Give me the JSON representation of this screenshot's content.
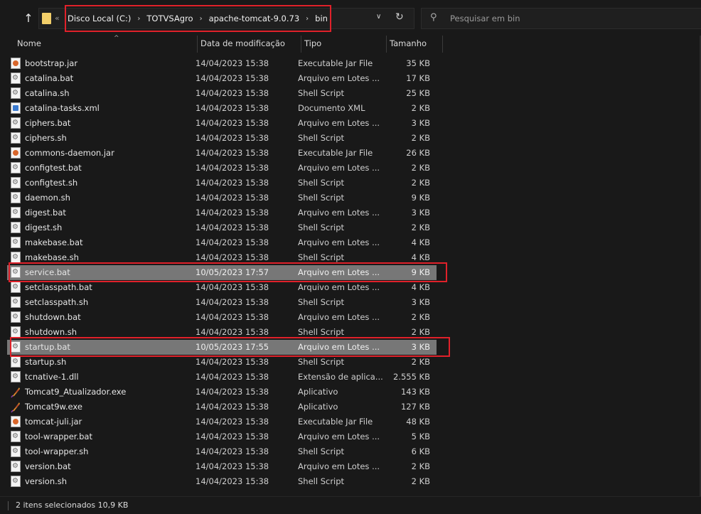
{
  "address": {
    "prefix": "«",
    "crumbs": [
      "Disco Local (C:)",
      "TOTVSAgro",
      "apache-tomcat-9.0.73",
      "bin"
    ]
  },
  "search": {
    "placeholder": "Pesquisar em bin"
  },
  "columns": {
    "name": "Nome",
    "date": "Data de modificação",
    "type": "Tipo",
    "size": "Tamanho"
  },
  "files": [
    {
      "name": "bootstrap.jar",
      "date": "14/04/2023 15:38",
      "type": "Executable Jar File",
      "size": "35 KB",
      "icon": "jar"
    },
    {
      "name": "catalina.bat",
      "date": "14/04/2023 15:38",
      "type": "Arquivo em Lotes ...",
      "size": "17 KB",
      "icon": "bat"
    },
    {
      "name": "catalina.sh",
      "date": "14/04/2023 15:38",
      "type": "Shell Script",
      "size": "25 KB",
      "icon": "sh"
    },
    {
      "name": "catalina-tasks.xml",
      "date": "14/04/2023 15:38",
      "type": "Documento XML",
      "size": "2 KB",
      "icon": "xml"
    },
    {
      "name": "ciphers.bat",
      "date": "14/04/2023 15:38",
      "type": "Arquivo em Lotes ...",
      "size": "3 KB",
      "icon": "bat"
    },
    {
      "name": "ciphers.sh",
      "date": "14/04/2023 15:38",
      "type": "Shell Script",
      "size": "2 KB",
      "icon": "sh"
    },
    {
      "name": "commons-daemon.jar",
      "date": "14/04/2023 15:38",
      "type": "Executable Jar File",
      "size": "26 KB",
      "icon": "jar"
    },
    {
      "name": "configtest.bat",
      "date": "14/04/2023 15:38",
      "type": "Arquivo em Lotes ...",
      "size": "2 KB",
      "icon": "bat"
    },
    {
      "name": "configtest.sh",
      "date": "14/04/2023 15:38",
      "type": "Shell Script",
      "size": "2 KB",
      "icon": "sh"
    },
    {
      "name": "daemon.sh",
      "date": "14/04/2023 15:38",
      "type": "Shell Script",
      "size": "9 KB",
      "icon": "sh"
    },
    {
      "name": "digest.bat",
      "date": "14/04/2023 15:38",
      "type": "Arquivo em Lotes ...",
      "size": "3 KB",
      "icon": "bat"
    },
    {
      "name": "digest.sh",
      "date": "14/04/2023 15:38",
      "type": "Shell Script",
      "size": "2 KB",
      "icon": "sh"
    },
    {
      "name": "makebase.bat",
      "date": "14/04/2023 15:38",
      "type": "Arquivo em Lotes ...",
      "size": "4 KB",
      "icon": "bat"
    },
    {
      "name": "makebase.sh",
      "date": "14/04/2023 15:38",
      "type": "Shell Script",
      "size": "4 KB",
      "icon": "sh"
    },
    {
      "name": "service.bat",
      "date": "10/05/2023 17:57",
      "type": "Arquivo em Lotes ...",
      "size": "9 KB",
      "icon": "bat",
      "selected": true
    },
    {
      "name": "setclasspath.bat",
      "date": "14/04/2023 15:38",
      "type": "Arquivo em Lotes ...",
      "size": "4 KB",
      "icon": "bat"
    },
    {
      "name": "setclasspath.sh",
      "date": "14/04/2023 15:38",
      "type": "Shell Script",
      "size": "3 KB",
      "icon": "sh"
    },
    {
      "name": "shutdown.bat",
      "date": "14/04/2023 15:38",
      "type": "Arquivo em Lotes ...",
      "size": "2 KB",
      "icon": "bat"
    },
    {
      "name": "shutdown.sh",
      "date": "14/04/2023 15:38",
      "type": "Shell Script",
      "size": "2 KB",
      "icon": "sh"
    },
    {
      "name": "startup.bat",
      "date": "10/05/2023 17:55",
      "type": "Arquivo em Lotes ...",
      "size": "3 KB",
      "icon": "bat",
      "selected": true
    },
    {
      "name": "startup.sh",
      "date": "14/04/2023 15:38",
      "type": "Shell Script",
      "size": "2 KB",
      "icon": "sh"
    },
    {
      "name": "tcnative-1.dll",
      "date": "14/04/2023 15:38",
      "type": "Extensão de aplica...",
      "size": "2.555 KB",
      "icon": "dll"
    },
    {
      "name": "Tomcat9_Atualizador.exe",
      "date": "14/04/2023 15:38",
      "type": "Aplicativo",
      "size": "143 KB",
      "icon": "exe"
    },
    {
      "name": "Tomcat9w.exe",
      "date": "14/04/2023 15:38",
      "type": "Aplicativo",
      "size": "127 KB",
      "icon": "exe"
    },
    {
      "name": "tomcat-juli.jar",
      "date": "14/04/2023 15:38",
      "type": "Executable Jar File",
      "size": "48 KB",
      "icon": "jar"
    },
    {
      "name": "tool-wrapper.bat",
      "date": "14/04/2023 15:38",
      "type": "Arquivo em Lotes ...",
      "size": "5 KB",
      "icon": "bat"
    },
    {
      "name": "tool-wrapper.sh",
      "date": "14/04/2023 15:38",
      "type": "Shell Script",
      "size": "6 KB",
      "icon": "sh"
    },
    {
      "name": "version.bat",
      "date": "14/04/2023 15:38",
      "type": "Arquivo em Lotes ...",
      "size": "2 KB",
      "icon": "bat"
    },
    {
      "name": "version.sh",
      "date": "14/04/2023 15:38",
      "type": "Shell Script",
      "size": "2 KB",
      "icon": "sh"
    }
  ],
  "status": {
    "text": "2 itens selecionados  10,9 KB"
  },
  "colors": {
    "selection": "#777777",
    "highlight": "#e0212a",
    "background": "#191919"
  }
}
